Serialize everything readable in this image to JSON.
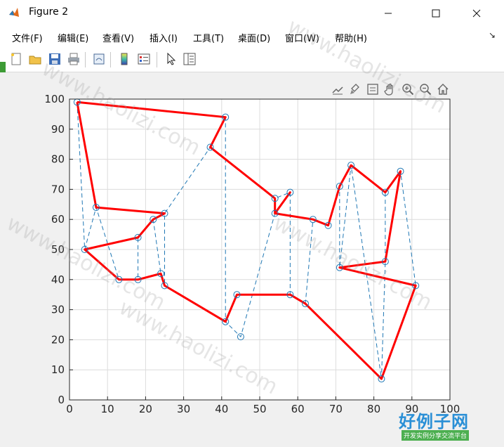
{
  "window": {
    "title": "Figure 2"
  },
  "menu": [
    "文件(F)",
    "编辑(E)",
    "查看(V)",
    "插入(I)",
    "工具(T)",
    "桌面(D)",
    "窗口(W)",
    "帮助(H)"
  ],
  "toolbar": [
    "new-figure-icon",
    "open-file-icon",
    "save-icon",
    "print-icon",
    "link-plot-icon",
    "colorbar-icon",
    "legend-icon",
    "pointer-icon",
    "property-inspector-icon"
  ],
  "axes_toolbar": [
    "export-icon",
    "brush-icon",
    "datatip-icon",
    "pan-icon",
    "zoom-in-icon",
    "zoom-out-icon",
    "home-icon"
  ],
  "watermark": {
    "text": "www.haolizi.com",
    "logo_main": "好例子网",
    "logo_sub": "开发实例分享交流平台"
  },
  "chart_data": {
    "type": "line",
    "xlim": [
      0,
      100
    ],
    "ylim": [
      0,
      100
    ],
    "grid": true,
    "xticks": [
      0,
      10,
      20,
      30,
      40,
      50,
      60,
      70,
      80,
      90,
      100
    ],
    "yticks": [
      0,
      10,
      20,
      30,
      40,
      50,
      60,
      70,
      80,
      90,
      100
    ],
    "xtick_labels": [
      "0",
      "10",
      "20",
      "30",
      "40",
      "50",
      "60",
      "70",
      "80",
      "90",
      "100"
    ],
    "ytick_labels": [
      "0",
      "10",
      "20",
      "30",
      "40",
      "50",
      "60",
      "70",
      "80",
      "90",
      "100"
    ],
    "colors": {
      "route": "#ff0000",
      "dashed": "#1f77b4",
      "marker": "#1f77b4"
    },
    "points": [
      {
        "x": 2,
        "y": 99
      },
      {
        "x": 7,
        "y": 64
      },
      {
        "x": 4,
        "y": 50
      },
      {
        "x": 13,
        "y": 40
      },
      {
        "x": 18,
        "y": 40
      },
      {
        "x": 18,
        "y": 54
      },
      {
        "x": 22,
        "y": 60
      },
      {
        "x": 25,
        "y": 62
      },
      {
        "x": 24,
        "y": 42
      },
      {
        "x": 25,
        "y": 38
      },
      {
        "x": 37,
        "y": 84
      },
      {
        "x": 41,
        "y": 94
      },
      {
        "x": 41,
        "y": 26
      },
      {
        "x": 44,
        "y": 35
      },
      {
        "x": 45,
        "y": 21
      },
      {
        "x": 54,
        "y": 67
      },
      {
        "x": 54,
        "y": 62
      },
      {
        "x": 58,
        "y": 69
      },
      {
        "x": 58,
        "y": 35
      },
      {
        "x": 62,
        "y": 32
      },
      {
        "x": 64,
        "y": 60
      },
      {
        "x": 68,
        "y": 58
      },
      {
        "x": 71,
        "y": 71
      },
      {
        "x": 71,
        "y": 44
      },
      {
        "x": 74,
        "y": 78
      },
      {
        "x": 82,
        "y": 7
      },
      {
        "x": 83,
        "y": 69
      },
      {
        "x": 83,
        "y": 46
      },
      {
        "x": 87,
        "y": 76
      },
      {
        "x": 91,
        "y": 38
      }
    ],
    "series": [
      {
        "style": "solid-red",
        "x": [
          2,
          41,
          37,
          54,
          54,
          58,
          54,
          64,
          68,
          71,
          74,
          83,
          87,
          83,
          71,
          91,
          82,
          62,
          58,
          44,
          41,
          25,
          24,
          18,
          13,
          4,
          18,
          22,
          25,
          7,
          2
        ],
        "y": [
          99,
          94,
          84,
          67,
          62,
          69,
          62,
          60,
          58,
          71,
          78,
          69,
          76,
          46,
          44,
          38,
          7,
          32,
          35,
          35,
          26,
          38,
          42,
          40,
          40,
          50,
          54,
          60,
          62,
          64,
          99
        ]
      },
      {
        "style": "dashed-blue",
        "x": [
          2,
          4,
          7,
          13,
          18,
          18,
          22,
          24,
          25,
          25,
          37,
          41,
          41,
          45,
          54,
          54,
          58,
          58,
          62,
          64,
          68,
          71,
          71,
          74,
          82,
          83,
          83,
          87,
          91
        ],
        "y": [
          99,
          50,
          64,
          40,
          40,
          54,
          60,
          42,
          38,
          62,
          84,
          94,
          26,
          21,
          62,
          67,
          69,
          35,
          32,
          60,
          58,
          71,
          44,
          78,
          7,
          46,
          69,
          76,
          38
        ]
      }
    ]
  }
}
